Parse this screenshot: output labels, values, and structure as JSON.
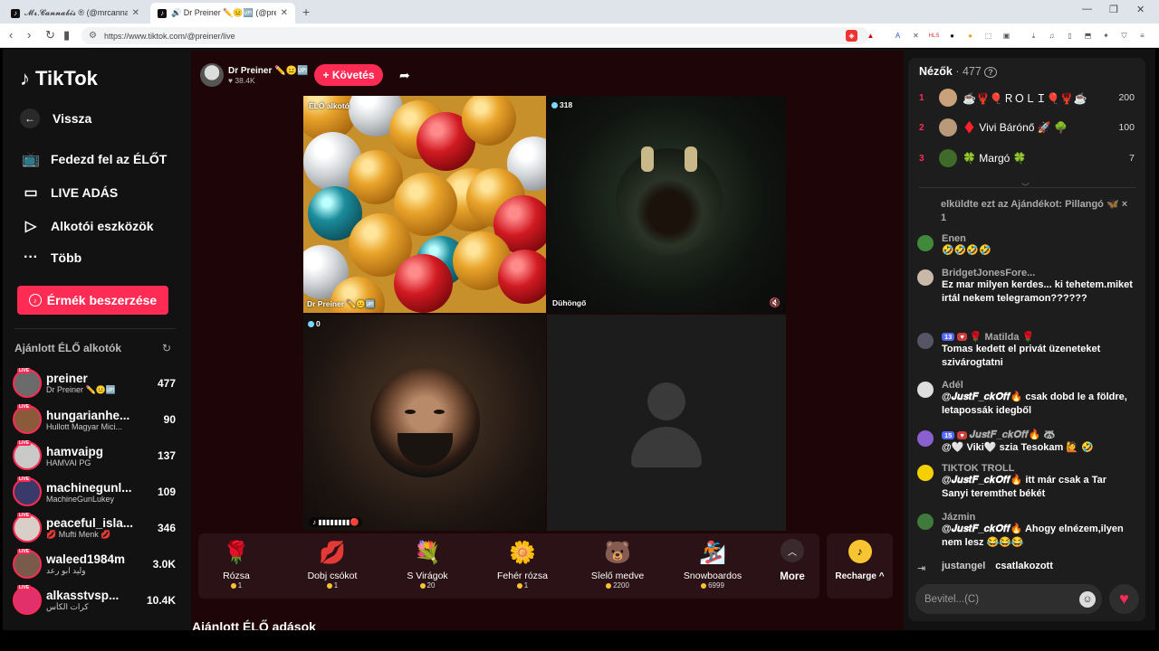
{
  "browser": {
    "tabs": [
      {
        "title": "𝓜𝓻.𝓒𝓪𝓷𝓷𝓪𝓫𝓲𝓼 ® (@mrcanna...",
        "active": false
      },
      {
        "title": "🔊 Dr Preiner ✏️😐🆙 (@preine...",
        "active": true
      }
    ],
    "new_tab": "+",
    "url": "https://www.tiktok.com/@preiner/live"
  },
  "sidebar": {
    "logo": "TikTok",
    "back": "Vissza",
    "nav": [
      {
        "label": "Fedezd fel az ÉLŐT",
        "icon": "tv-icon"
      },
      {
        "label": "LIVE ADÁS",
        "icon": "camera-icon"
      },
      {
        "label": "Alkotói eszközök",
        "icon": "creator-tools-icon"
      },
      {
        "label": "Több",
        "icon": "more-icon"
      }
    ],
    "coins_button": "Érmék beszerzése",
    "recommended_title": "Ajánlott ÉLŐ alkotók",
    "live_badge": "LIVE",
    "creators": [
      {
        "name": "preiner",
        "sub": "Dr Preiner ✏️😐🆙",
        "count": "477",
        "color": "#6b6b6b"
      },
      {
        "name": "hungarianhe...",
        "sub": "Hullott Magyar Mici...",
        "count": "90",
        "color": "#8a5a3a"
      },
      {
        "name": "hamvaipg",
        "sub": "HAMVAI PG",
        "count": "137",
        "color": "#c9c9c9"
      },
      {
        "name": "machinegunl...",
        "sub": "MachineGunLukey",
        "count": "109",
        "color": "#3a3a6a"
      },
      {
        "name": "peaceful_isla...",
        "sub": "💋 Mufti Menk 💋",
        "count": "346",
        "color": "#d8d0c8"
      },
      {
        "name": "waleed1984m",
        "sub": "وليد ابو رعد",
        "count": "3.0K",
        "color": "#7a5a4a"
      },
      {
        "name": "alkasstvsp...",
        "sub": "كرات الكأس",
        "count": "10.4K",
        "color": "#e1306c"
      }
    ]
  },
  "main": {
    "host": {
      "name": "Dr Preiner ✏️😐🆙",
      "likes": "♥ 38.4K"
    },
    "follow": "+ Követés",
    "cells": {
      "c1_label": "ÉLŐ alkotó",
      "c1_name": "Dr Preiner ✏️😐🆙",
      "c2_viewers": "318",
      "c2_name": "Dühöngő",
      "c3_viewers": "0",
      "c3_bottom": "♪ ▮▮▮▮▮▮▮▮🔴"
    },
    "gifts": [
      {
        "name": "Rózsa",
        "price": "1",
        "icon": "🌹"
      },
      {
        "name": "Dobj csókot",
        "price": "1",
        "icon": "💋"
      },
      {
        "name": "S Virágok",
        "price": "20",
        "icon": "💐"
      },
      {
        "name": "Fehér rózsa",
        "price": "1",
        "icon": "🌼"
      },
      {
        "name": "Sîelő medve",
        "price": "2200",
        "icon": "🐻"
      },
      {
        "name": "Snowboardos",
        "price": "6999",
        "icon": "🏂"
      }
    ],
    "more": "More",
    "recharge": "Recharge ^",
    "recommended_live": "Ajánlott ÉLŐ adások"
  },
  "viewers": {
    "title": "Nézők",
    "count": "· 477",
    "help": "?",
    "ranking": [
      {
        "rank": "1",
        "name": "☕🦞🎈ＲＯＬＩ🎈🦞☕",
        "score": "200"
      },
      {
        "rank": "2",
        "name": "♦️ Vivi Bárónő 🚀 🌳",
        "score": "100"
      },
      {
        "rank": "3",
        "name": "🍀 Margó 🍀",
        "score": "7"
      }
    ]
  },
  "chat": {
    "messages": [
      {
        "user": "",
        "text": "elküldte ezt az Ajándékot: Pillangó 🦋 × 1",
        "color": "#5a3a2a"
      },
      {
        "user": "Enen",
        "text": "🤣🤣🤣🤣",
        "color": "#3f8a3a"
      },
      {
        "user": "⁣⁣BridgetJonesFore...",
        "text": "Ez mar milyen kerdes... ki tehetem.miket irtál nekem telegramon??????",
        "color": "#c8b8a8"
      },
      {
        "user": "🌹 Matilda 🌹",
        "badges": [
          "13",
          "♥"
        ],
        "text": "Tomas kedett el privát üzeneteket szivárogtatni",
        "color": "#556"
      },
      {
        "user": "Adél",
        "text": "@𝑱𝒖𝒔𝒕𝑭_𝒄𝒌𝑶𝒇𝒇🔥 csak dobd le a földre, letapossák idegből",
        "color": "#ddd"
      },
      {
        "user": "𝑱𝒖𝒔𝒕𝑭_𝒄𝒌𝑶𝒇𝒇🔥 🦝",
        "badges": [
          "15",
          "♥"
        ],
        "text": "@🤍 Viki🤍 szia Tesokam 🙋 🤣",
        "color": "#8a5fd0"
      },
      {
        "user": "TIKTOK TROLL",
        "text": "@𝑱𝒖𝒔𝒕𝑭_𝒄𝒌𝑶𝒇𝒇🔥 itt már csak a Tar Sanyi teremthet békét",
        "color": "#f5d000"
      },
      {
        "user": "Jázmin",
        "text": "@𝑱𝒖𝒔𝒕𝑭_𝒄𝒌𝑶𝒇𝒇🔥 Ahogy elnézem,ilyen nem lesz 😂😂😂",
        "color": "#3f7a3a"
      },
      {
        "user": "justangel⁣⁣⁣",
        "text": "csatlakozott",
        "color": ""
      }
    ],
    "input_placeholder": "Bevitel...(C)"
  }
}
